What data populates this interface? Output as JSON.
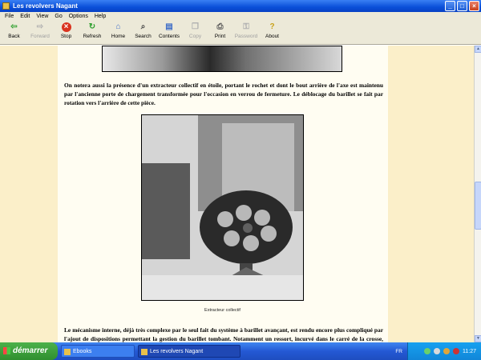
{
  "window": {
    "title": "Les revolvers Nagant",
    "buttons": [
      "minimize",
      "maximize",
      "close"
    ]
  },
  "menu": [
    "File",
    "Edit",
    "View",
    "Go",
    "Options",
    "Help"
  ],
  "toolbar": [
    {
      "label": "Back",
      "icon": "back-arrow-icon",
      "enabled": true
    },
    {
      "label": "Forward",
      "icon": "forward-arrow-icon",
      "enabled": false
    },
    {
      "label": "Stop",
      "icon": "stop-icon",
      "enabled": true
    },
    {
      "label": "Refresh",
      "icon": "refresh-icon",
      "enabled": true
    },
    {
      "label": "Home",
      "icon": "home-icon",
      "enabled": true
    },
    {
      "label": "Search",
      "icon": "search-icon",
      "enabled": true
    },
    {
      "label": "Contents",
      "icon": "contents-icon",
      "enabled": true
    },
    {
      "label": "Copy",
      "icon": "copy-icon",
      "enabled": false
    },
    {
      "label": "Print",
      "icon": "print-icon",
      "enabled": true
    },
    {
      "label": "Password",
      "icon": "key-icon",
      "enabled": false
    },
    {
      "label": "About",
      "icon": "about-icon",
      "enabled": true
    }
  ],
  "document": {
    "paragraph1": "On notera aussi la présence d'un extracteur collectif en étoile, portant le rochet et dont le bout arrière de l'axe est maintenu par l'ancienne porte de chargement transformée pour l'occasion en verrou de fermeture. Le déblocage du barillet se fait par rotation vers l'arrière de cette pièce.",
    "caption": "Extracteur collectif",
    "paragraph2": "Le mécanisme interne, déjà très complexe par le seul fait du système à barillet avançant, est rendu encore plus compliqué par l'ajout de dispositions permettant la gestion du barillet tombant. Notamment un ressort, incurvé dans le carré de la crosse, destiné à pousser l'ancienne partie de chargement"
  },
  "taskbar": {
    "start_label": "démarrer",
    "tasks": [
      "Ebooks",
      "Les revolvers Nagant"
    ],
    "language": "FR",
    "clock": "11:27"
  },
  "colors": {
    "page_bg": "#fffdf2",
    "margin_bg": "#fbefc9",
    "title_bar": "#0a4fd8",
    "taskbar": "#2459d4",
    "start_button": "#3a9f3a"
  }
}
